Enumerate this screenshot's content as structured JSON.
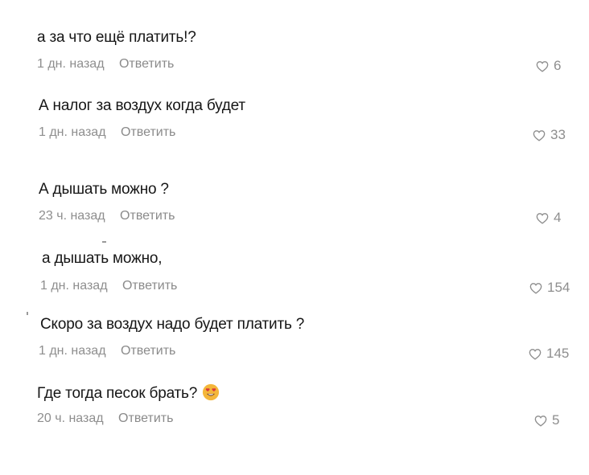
{
  "comments": [
    {
      "text": "а за что ещё платить!?",
      "time": "1 дн. назад",
      "reply": "Ответить",
      "likes": "6"
    },
    {
      "text": "А налог за воздух когда будет",
      "time": "1 дн. назад",
      "reply": "Ответить",
      "likes": "33"
    },
    {
      "text": "А дышать можно ?",
      "time": "23 ч. назад",
      "reply": "Ответить",
      "likes": "4"
    },
    {
      "text": "а дышать можно,",
      "time": "1 дн. назад",
      "reply": "Ответить",
      "likes": "154"
    },
    {
      "text": "Скоро за воздух надо будет платить ?",
      "time": "1 дн. назад",
      "reply": "Ответить",
      "likes": "145"
    },
    {
      "text": "Где тогда песок брать?",
      "time": "20 ч. назад",
      "reply": "Ответить",
      "likes": "5",
      "emoji": "heart-eyes-emoji"
    }
  ],
  "colors": {
    "text": "#161616",
    "meta": "#8e8e8e",
    "emoji": "#f4b63a"
  }
}
